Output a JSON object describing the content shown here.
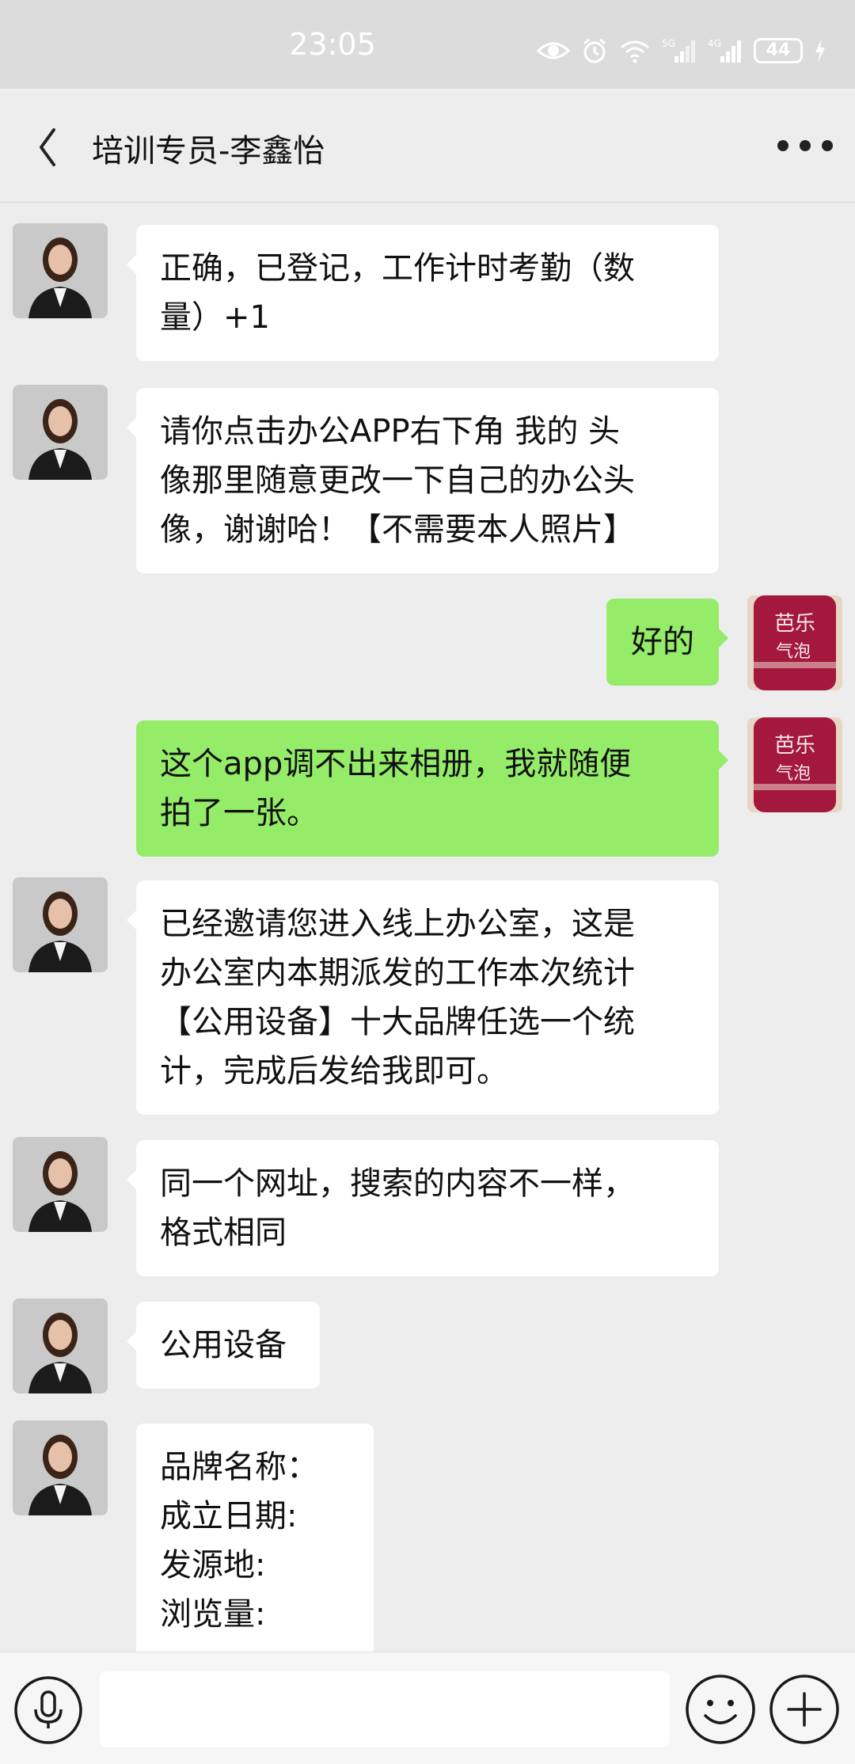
{
  "status_bar": {
    "time": "23:05",
    "network_1": "5G",
    "network_2": "4G",
    "battery": "44",
    "icons": [
      "eye-icon",
      "alarm-icon",
      "wifi-icon",
      "signal-5g-icon",
      "signal-4g-icon",
      "battery-icon",
      "charging-icon"
    ]
  },
  "header": {
    "back_icon": "back-chevron-icon",
    "title": "培训专员-李鑫怡",
    "more_icon": "more-dots-icon"
  },
  "messages": [
    {
      "side": "in",
      "text": "正确，已登记，工作计时考勤（数\n量）+1"
    },
    {
      "side": "in",
      "text": "请你点击办公APP右下角 我的 头\n像那里随意更改一下自己的办公头\n像，谢谢哈！【不需要本人照片】"
    },
    {
      "side": "out",
      "text": "好的"
    },
    {
      "side": "out",
      "text": "这个app调不出来相册，我就随便\n拍了一张。"
    },
    {
      "side": "in",
      "text": "已经邀请您进入线上办公室，这是\n办公室内本期派发的工作本次统计\n【公用设备】十大品牌任选一个统\n计，完成后发给我即可。"
    },
    {
      "side": "in",
      "text": "同一个网址，搜索的内容不一样，\n格式相同"
    },
    {
      "side": "in",
      "text": "公用设备"
    },
    {
      "side": "in",
      "text": "品牌名称：\n成立日期:\n发源地:\n浏览量:"
    }
  ],
  "avatar_in_text": "",
  "avatar_out_text": "芭乐\n气泡",
  "input_bar": {
    "voice_icon": "microphone-icon",
    "text_value": "",
    "emoji_icon": "emoji-smile-icon",
    "plus_icon": "plus-icon"
  },
  "colors": {
    "background": "#ededed",
    "bubble_out": "#95ec69",
    "bubble_in": "#ffffff"
  }
}
